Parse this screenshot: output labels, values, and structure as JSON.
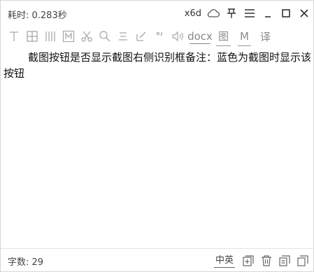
{
  "header": {
    "time_label": "耗时: 0.283秒",
    "engine_label": "x6d"
  },
  "icons": {
    "cloud": "cloud-icon",
    "pin": "pin-icon",
    "menu": "menu-icon",
    "minimize": "minimize-icon",
    "maximize": "maximize-icon",
    "close": "close-icon"
  },
  "toolbar": {
    "docx_label": "docx",
    "image_label": "图",
    "markdown_label": "M",
    "translate_label": "译"
  },
  "content": {
    "text": "截图按钮是否显示截图右侧识别框备注：蓝色为截图时显示该按钮"
  },
  "status": {
    "char_count": "字数: 29",
    "lang_toggle": "中英"
  },
  "colors": {
    "icon_dark": "#333333",
    "icon_light": "#a8a8a8",
    "text": "#111111"
  }
}
